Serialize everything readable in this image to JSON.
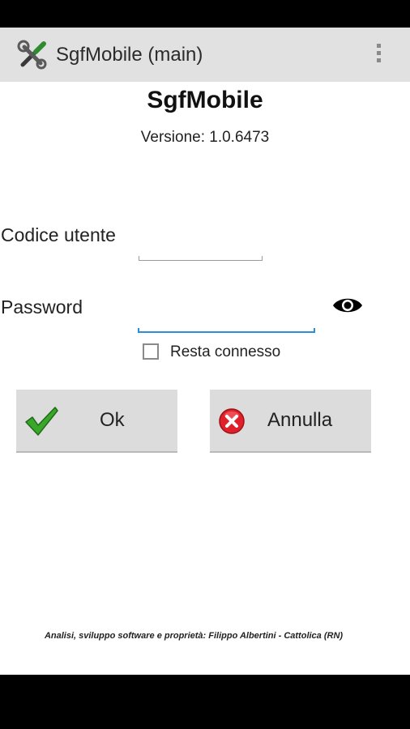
{
  "app": {
    "title": "SgfMobile (main)",
    "icon": "tools-icon",
    "overflow_icon": "overflow-menu-icon"
  },
  "main": {
    "heading": "SgfMobile",
    "version": "Versione: 1.0.6473"
  },
  "form": {
    "user_label": "Codice utente",
    "user_value": "",
    "password_label": "Password",
    "password_value": "",
    "show_password_icon": "eye-icon",
    "remember_label": "Resta connesso",
    "remember_checked": false
  },
  "buttons": {
    "ok_label": "Ok",
    "ok_icon": "checkmark-icon",
    "cancel_label": "Annulla",
    "cancel_icon": "cancel-icon"
  },
  "footer": {
    "text": "Analisi, sviluppo software e proprietà: Filippo Albertini - Cattolica (RN)"
  },
  "colors": {
    "action_bar": "#e1e1e1",
    "focus_accent": "#2a8fd8",
    "ok_green": "#3aa62a",
    "cancel_red": "#e0202a"
  }
}
